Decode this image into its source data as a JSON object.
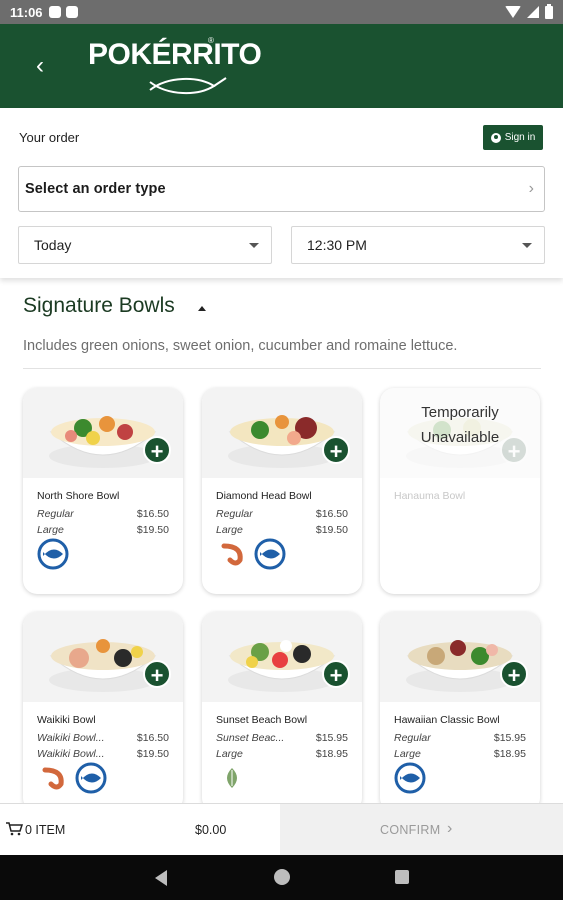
{
  "status_bar": {
    "time": "11:06"
  },
  "header": {
    "logo_text": "POKÉRRITO",
    "logo_mark": "®"
  },
  "order": {
    "your_order_label": "Your order",
    "signin_label": "Sign in",
    "order_type_label": "Select an order type",
    "day_value": "Today",
    "time_value": "12:30 PM"
  },
  "section": {
    "title": "Signature Bowls",
    "description": "Includes green onions, sweet onion, cucumber and romaine lettuce."
  },
  "products": [
    {
      "name": "North Shore Bowl",
      "prices": [
        {
          "size": "Regular",
          "price": "$16.50"
        },
        {
          "size": "Large",
          "price": "$19.50"
        }
      ],
      "diet_icons": [
        "fish-icon"
      ]
    },
    {
      "name": "Diamond Head Bowl",
      "prices": [
        {
          "size": "Regular",
          "price": "$16.50"
        },
        {
          "size": "Large",
          "price": "$19.50"
        }
      ],
      "diet_icons": [
        "shrimp-icon",
        "fish-icon"
      ]
    },
    {
      "name": "Hanauma Bowl",
      "unavailable_label": "Temporarily Unavailable",
      "prices": [],
      "diet_icons": []
    },
    {
      "name": "Waikiki Bowl",
      "prices": [
        {
          "size": "Waikiki Bowl...",
          "price": "$16.50"
        },
        {
          "size": "Waikiki Bowl...",
          "price": "$19.50"
        }
      ],
      "diet_icons": [
        "shrimp-icon",
        "fish-icon"
      ]
    },
    {
      "name": "Sunset Beach Bowl",
      "prices": [
        {
          "size": "Sunset Beac...",
          "price": "$15.95"
        },
        {
          "size": "Large",
          "price": "$18.95"
        }
      ],
      "diet_icons": [
        "leaf-icon"
      ]
    },
    {
      "name": "Hawaiian Classic Bowl",
      "prices": [
        {
          "size": "Regular",
          "price": "$15.95"
        },
        {
          "size": "Large",
          "price": "$18.95"
        }
      ],
      "diet_icons": [
        "fish-icon"
      ]
    }
  ],
  "cart": {
    "item_count": "0 ITEM",
    "total": "$0.00",
    "confirm_label": "CONFIRM"
  },
  "colors": {
    "brand_green": "#1a5230",
    "fish_blue": "#1f5fa8",
    "shrimp_orange": "#d2683c"
  }
}
